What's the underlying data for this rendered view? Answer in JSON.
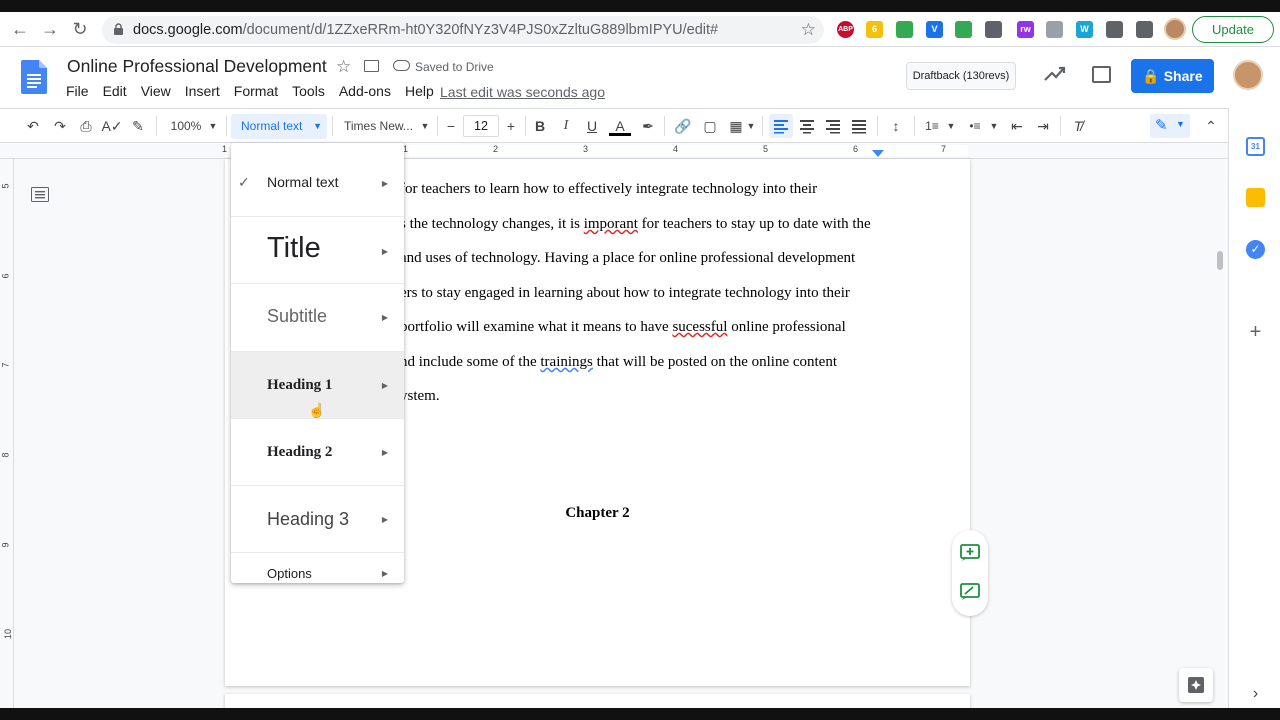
{
  "browser": {
    "url_host": "docs.google.com",
    "url_path": "/document/d/1ZZxeRRm-ht0Y320fNYz3V4PJS0xZzltuG889lbmIPYU/edit#",
    "update_label": "Update",
    "extensions": [
      {
        "name": "abp-icon",
        "text": "ABP",
        "color": "#c70d2c"
      },
      {
        "name": "sticky-notes-icon",
        "text": "6",
        "color": "#f4c20d"
      },
      {
        "name": "google-drive-icon",
        "text": "",
        "color": "#34a853"
      },
      {
        "name": "vocab-icon",
        "text": "V",
        "color": "#1a73e8"
      },
      {
        "name": "grammar-icon",
        "text": "",
        "color": "#34a853"
      },
      {
        "name": "camera-icon",
        "text": "",
        "color": "#5f6368"
      },
      {
        "name": "readwrite-icon",
        "text": "rw",
        "color": "#9334e6"
      },
      {
        "name": "document-icon",
        "text": "",
        "color": "#9aa0a6"
      },
      {
        "name": "w-icon",
        "text": "W",
        "color": "#1aa5d6"
      },
      {
        "name": "puzzle-icon",
        "text": "",
        "color": "#5f6368"
      },
      {
        "name": "media-icon",
        "text": "",
        "color": "#5f6368"
      }
    ]
  },
  "doc": {
    "title": "Online Professional Development",
    "saved_status": "Saved to Drive",
    "last_edit": "Last edit was seconds ago",
    "menu": [
      "File",
      "Edit",
      "View",
      "Insert",
      "Format",
      "Tools",
      "Add-ons",
      "Help"
    ],
    "draftback_label": "Draftback (130revs)",
    "share_label": "Share"
  },
  "toolbar": {
    "zoom": "100%",
    "style": "Normal text",
    "font": "Times New...",
    "font_size": "12"
  },
  "ruler_numbers": [
    "1",
    "1",
    "2",
    "3",
    "4",
    "5",
    "6",
    "7"
  ],
  "vruler_numbers": [
    "5",
    "6",
    "7",
    "8",
    "9",
    "10"
  ],
  "document_text": {
    "lines": [
      "for teachers to learn how to effectively integrate technology into their",
      "s the technology changes, it is imporant for teachers to stay up to date with the",
      "and uses of technology.  Having a place for online professional development",
      "ers to stay engaged in learning about how to integrate technology into their",
      "portfolio will examine what it means to have sucessful online professional",
      "nd include some of the trainings that will be posted on the online content",
      "ystem."
    ],
    "line2_pre": "s the technology changes, it is ",
    "line2_err": "imporant",
    "line2_post": " for teachers to stay up to date with the",
    "line5_pre": "portfolio will examine what it means to have ",
    "line5_err": "sucessful",
    "line5_post": " online professional",
    "line6_pre": "nd include some of the ",
    "line6_err": "trainings",
    "line6_post": " that will be posted on the online content",
    "chapter": "Chapter 2"
  },
  "style_menu": {
    "items": [
      {
        "label": "Normal text",
        "checked": true
      },
      {
        "label": "Title"
      },
      {
        "label": "Subtitle"
      },
      {
        "label": "Heading 1",
        "hovered": true
      },
      {
        "label": "Heading 2"
      },
      {
        "label": "Heading 3"
      },
      {
        "label": "Options"
      }
    ]
  },
  "colors": {
    "accent": "#1a73e8",
    "update_green": "#1e8e3e"
  }
}
